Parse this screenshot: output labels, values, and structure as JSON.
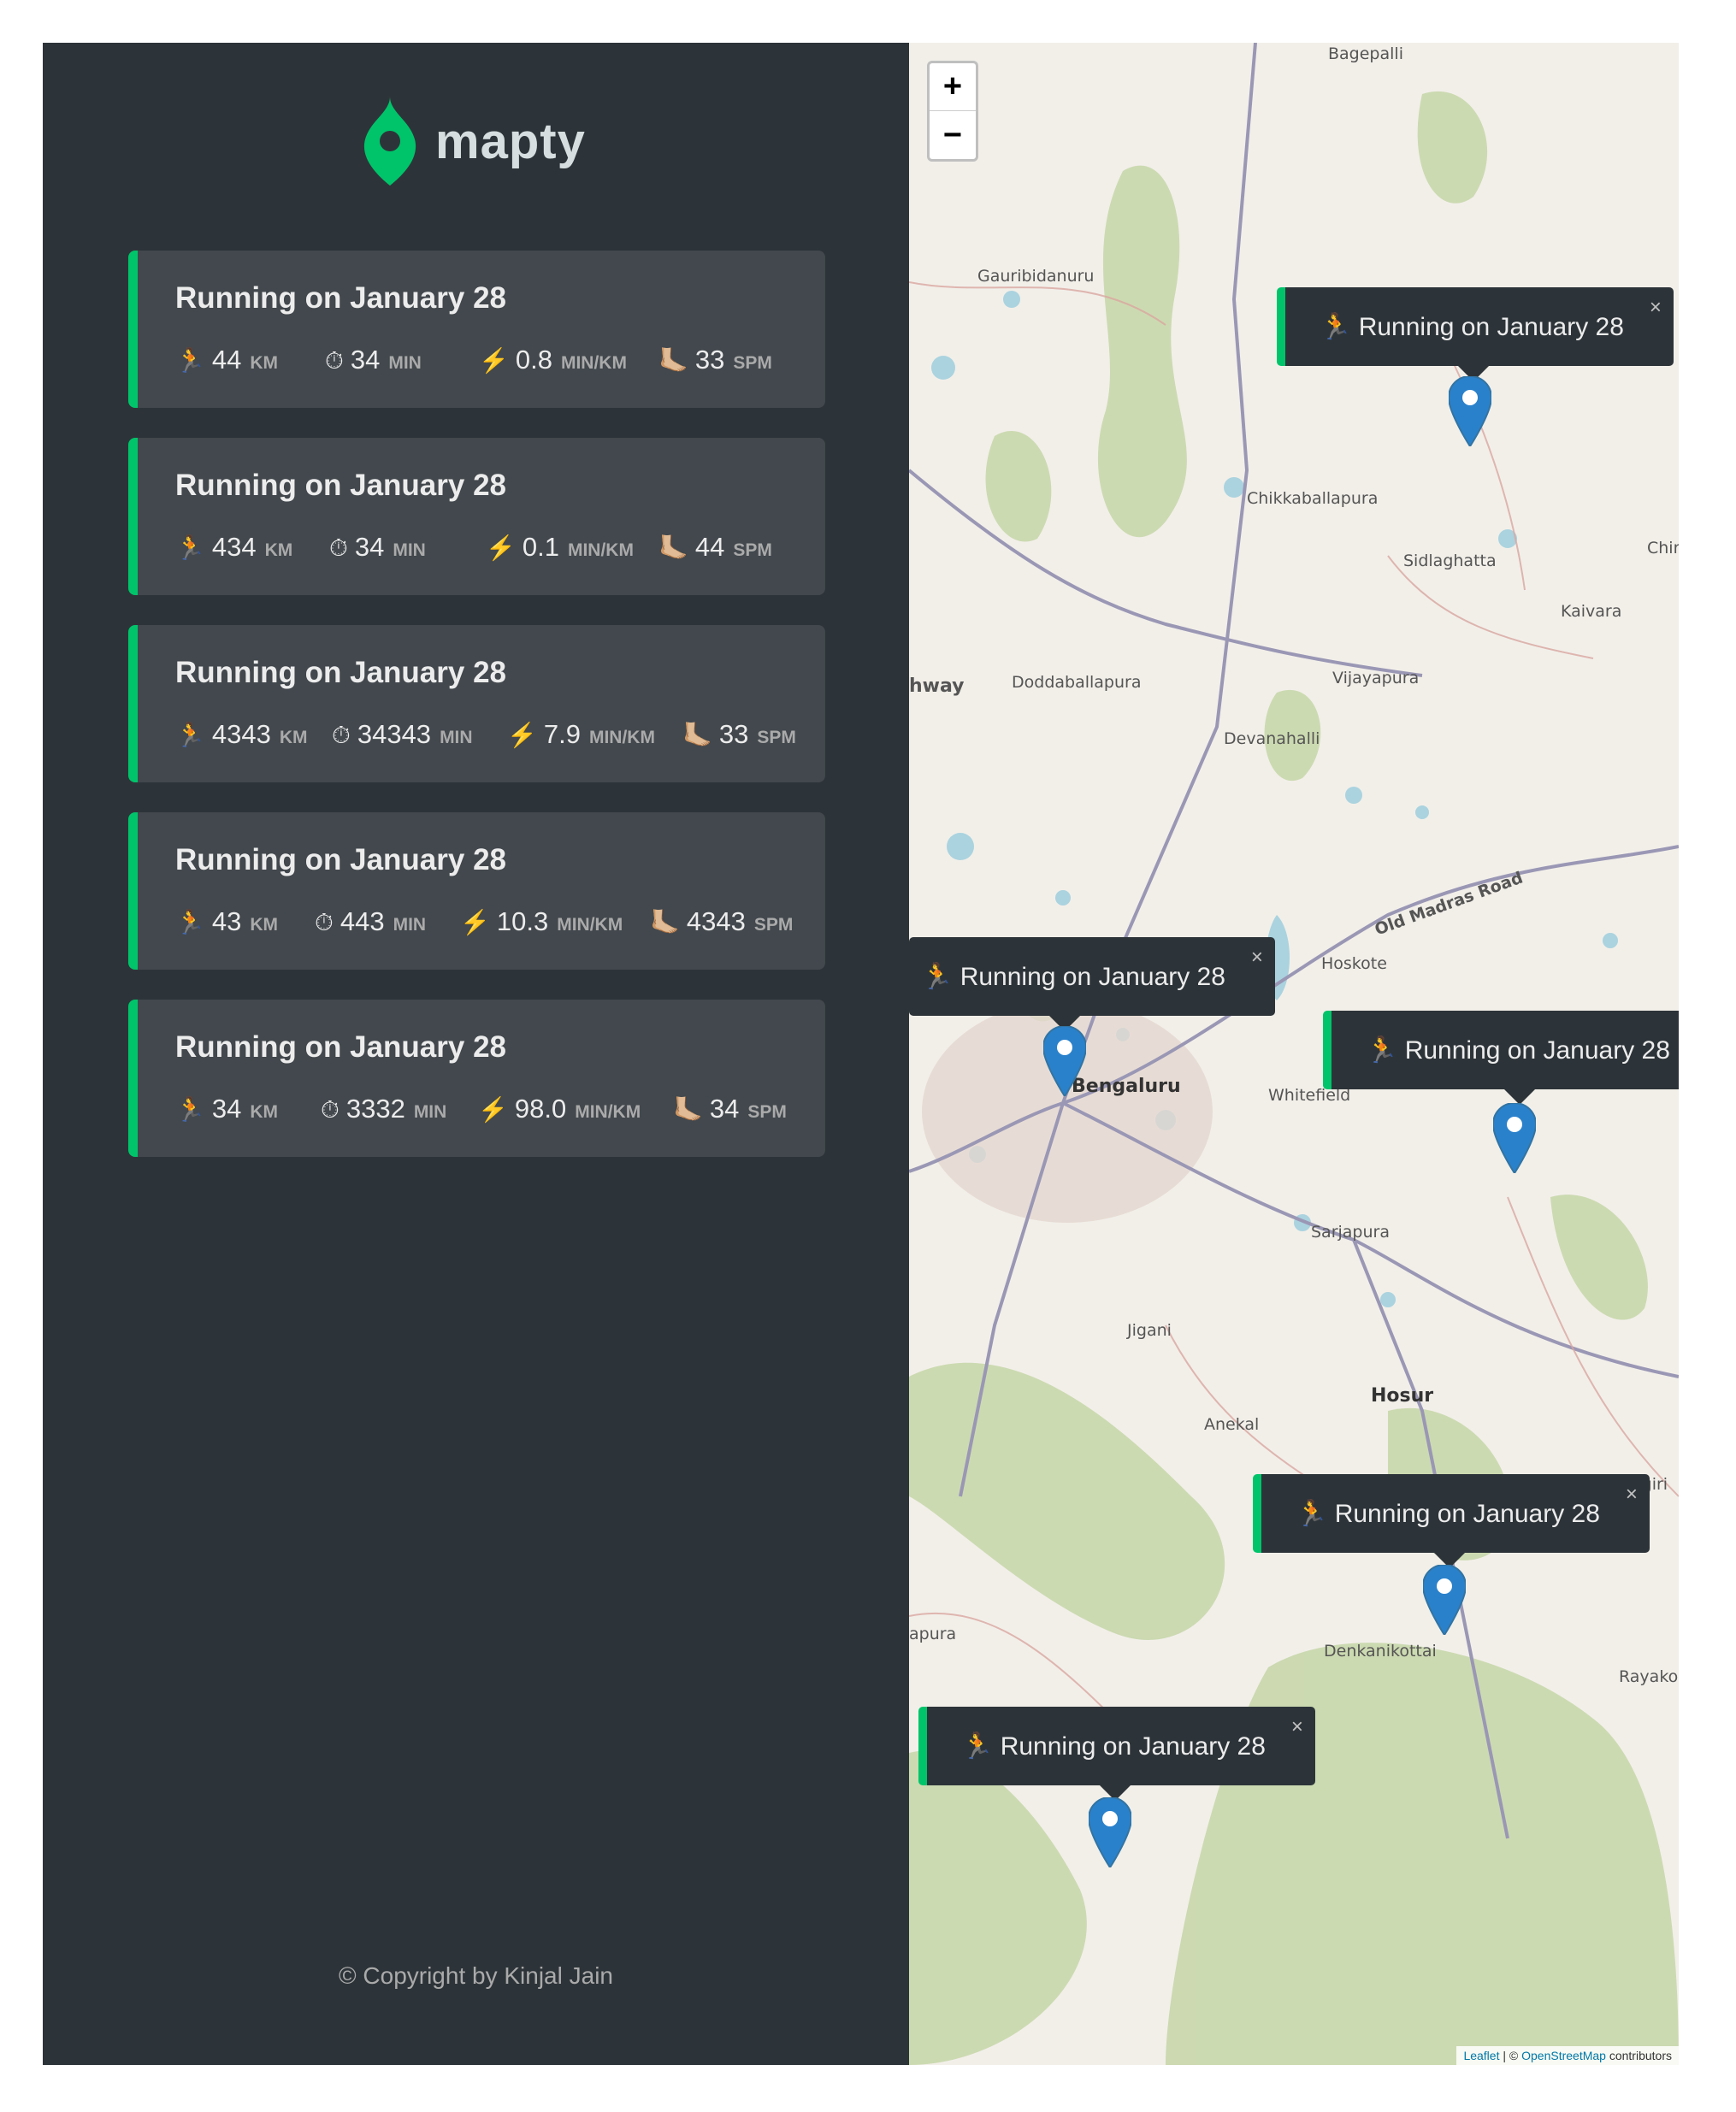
{
  "app": {
    "name": "mapty"
  },
  "workouts": [
    {
      "title": "Running on January 28",
      "distance": {
        "icon": "🏃",
        "value": "44",
        "unit": "km"
      },
      "duration": {
        "icon": "⏱",
        "value": "34",
        "unit": "min"
      },
      "pace": {
        "icon": "⚡️",
        "value": "0.8",
        "unit": "min/km"
      },
      "cadence": {
        "icon": "🦶🏼",
        "value": "33",
        "unit": "spm"
      }
    },
    {
      "title": "Running on January 28",
      "distance": {
        "icon": "🏃",
        "value": "434",
        "unit": "km"
      },
      "duration": {
        "icon": "⏱",
        "value": "34",
        "unit": "min"
      },
      "pace": {
        "icon": "⚡️",
        "value": "0.1",
        "unit": "min/km"
      },
      "cadence": {
        "icon": "🦶🏼",
        "value": "44",
        "unit": "spm"
      }
    },
    {
      "title": "Running on January 28",
      "distance": {
        "icon": "🏃",
        "value": "4343",
        "unit": "km"
      },
      "duration": {
        "icon": "⏱",
        "value": "34343",
        "unit": "min"
      },
      "pace": {
        "icon": "⚡️",
        "value": "7.9",
        "unit": "min/km"
      },
      "cadence": {
        "icon": "🦶🏼",
        "value": "33",
        "unit": "spm"
      }
    },
    {
      "title": "Running on January 28",
      "distance": {
        "icon": "🏃",
        "value": "43",
        "unit": "km"
      },
      "duration": {
        "icon": "⏱",
        "value": "443",
        "unit": "min"
      },
      "pace": {
        "icon": "⚡️",
        "value": "10.3",
        "unit": "min/km"
      },
      "cadence": {
        "icon": "🦶🏼",
        "value": "4343",
        "unit": "spm"
      }
    },
    {
      "title": "Running on January 28",
      "distance": {
        "icon": "🏃",
        "value": "34",
        "unit": "km"
      },
      "duration": {
        "icon": "⏱",
        "value": "3332",
        "unit": "min"
      },
      "pace": {
        "icon": "⚡️",
        "value": "98.0",
        "unit": "min/km"
      },
      "cadence": {
        "icon": "🦶🏼",
        "value": "34",
        "unit": "spm"
      }
    }
  ],
  "copyright": "© Copyright by Kinjal Jain",
  "map": {
    "zoom_in": "+",
    "zoom_out": "−",
    "popups": [
      {
        "text": "🏃 Running on January 28",
        "close": "×"
      },
      {
        "text": "🏃 Running on January 28",
        "close": "×"
      },
      {
        "text": "🏃 Running on January 28",
        "close": "×"
      },
      {
        "text": "🏃 Running on January 28",
        "close": "×"
      },
      {
        "text": "🏃 Running on January 28",
        "close": "×"
      }
    ],
    "places": [
      "Bagepalli",
      "Gauribidanuru",
      "Chikkaballapura",
      "Sidlaghatta",
      "Chir",
      "Kaivara",
      "hway",
      "Doddaballapura",
      "Vijayapura",
      "Devanahalli",
      "Old Madras Road",
      "Hoskote",
      "Bengaluru",
      "Whitefield",
      "Sarjapura",
      "Jigani",
      "Hosur",
      "Anekal",
      "agiri",
      "apura",
      "Denkanikottai",
      "Rayako"
    ],
    "attribution": {
      "leaflet": "Leaflet",
      "sep": " | © ",
      "osm": "OpenStreetMap",
      "suffix": " contributors"
    }
  },
  "colors": {
    "accent_green": "#00c46a",
    "sidebar_bg": "#2d3439",
    "card_bg": "#42484d",
    "marker_blue": "#2a81cb"
  }
}
